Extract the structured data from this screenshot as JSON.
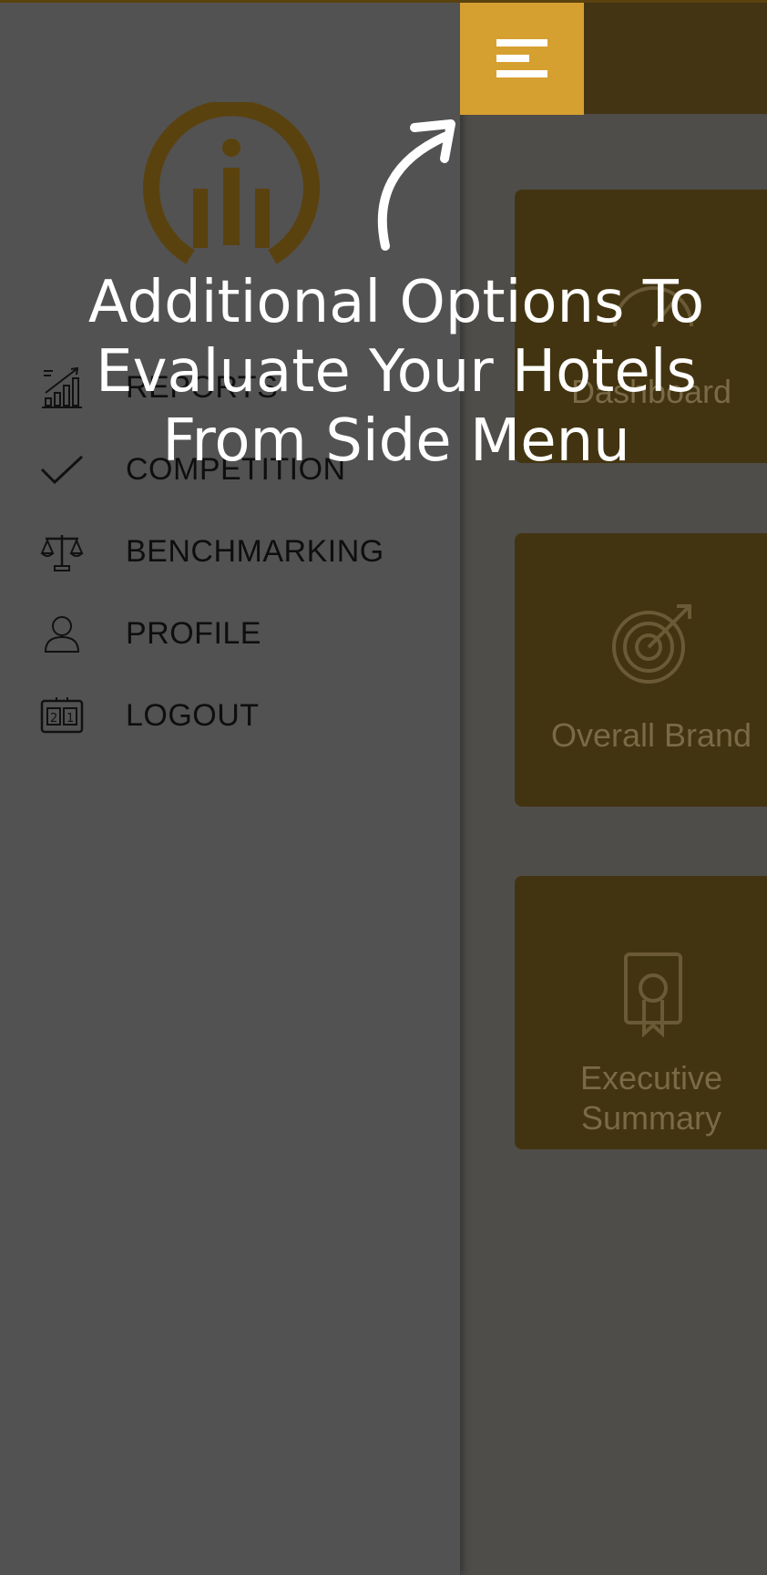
{
  "overlay": {
    "tip_line1": "Additional Options To",
    "tip_line2": "Evaluate Your Hotels",
    "tip_line3": "From Side Menu"
  },
  "sidebar": {
    "items": [
      {
        "label": "REPORTS",
        "icon": "growth-chart-icon"
      },
      {
        "label": "COMPETITION",
        "icon": "checkmark-icon"
      },
      {
        "label": "BENCHMARKING",
        "icon": "scales-icon"
      },
      {
        "label": "PROFILE",
        "icon": "user-icon"
      },
      {
        "label": "LOGOUT",
        "icon": "scoreboard-icon"
      }
    ]
  },
  "header": {
    "menu_icon": "hamburger-menu-icon"
  },
  "cards": [
    {
      "label": "Dashboard",
      "icon": "speedometer-icon"
    },
    {
      "label": "Overall Brand",
      "icon": "target-icon"
    },
    {
      "label_line1": "Executive",
      "label_line2": "Summary",
      "icon": "certificate-icon"
    }
  ],
  "colors": {
    "accent": "#d6a030",
    "header_bg": "#433413",
    "card_bg": "#433411",
    "drawer_bg": "#525252",
    "logo": "#5a420f"
  }
}
